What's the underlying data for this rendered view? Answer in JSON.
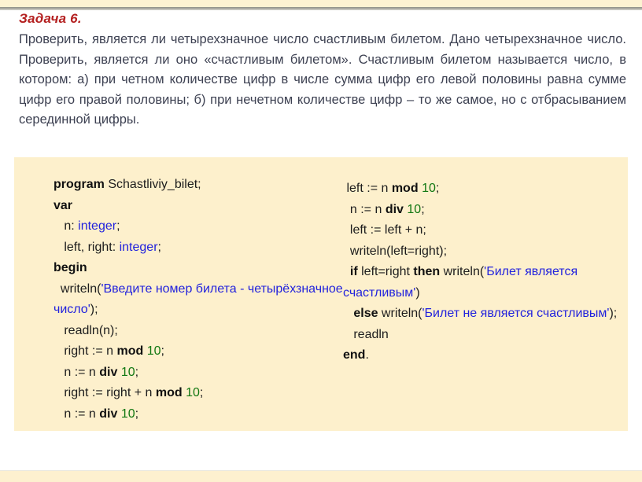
{
  "slide": {
    "task_title": "Задача 6.",
    "task_body": "Проверить, является ли четырехзначное число счастливым билетом. Дано четырехзначное число. Проверить, является ли оно «счастливым билетом». Счастливым билетом называется число, в котором: а) при четном количестве цифр в числе сумма цифр его левой половины равна сумме цифр его правой половины; б) при нечетном количестве цифр – то же самое, но с отбрасыванием серединной цифры.",
    "colors": {
      "title": "#b42020",
      "body_text": "#3d4152",
      "panel_background": "#fdf0cc",
      "band": "#fdf0cf",
      "keyword": "#111111",
      "string": "#2222dd",
      "type": "#2222dd",
      "number": "#117711"
    }
  },
  "code": {
    "left_column": [
      {
        "tokens": [
          {
            "t": "program",
            "c": "kw"
          },
          {
            "t": " Schastliviy_bilet;",
            "c": "plain"
          }
        ]
      },
      {
        "tokens": [
          {
            "t": "var",
            "c": "kw"
          }
        ]
      },
      {
        "tokens": [
          {
            "t": "   n: ",
            "c": "plain"
          },
          {
            "t": "integer",
            "c": "type"
          },
          {
            "t": ";",
            "c": "plain"
          }
        ]
      },
      {
        "tokens": [
          {
            "t": "   left, right: ",
            "c": "plain"
          },
          {
            "t": "integer",
            "c": "type"
          },
          {
            "t": ";",
            "c": "plain"
          }
        ]
      },
      {
        "tokens": [
          {
            "t": "begin",
            "c": "kw"
          }
        ]
      },
      {
        "tokens": [
          {
            "t": "  writeln(",
            "c": "plain"
          },
          {
            "t": "'Введите номер билета - четырёхзначное число'",
            "c": "str"
          },
          {
            "t": ");",
            "c": "plain"
          }
        ]
      },
      {
        "tokens": [
          {
            "t": "   readln(n);",
            "c": "plain"
          }
        ]
      },
      {
        "tokens": [
          {
            "t": "   right := n ",
            "c": "plain"
          },
          {
            "t": "mod",
            "c": "kw"
          },
          {
            "t": " ",
            "c": "plain"
          },
          {
            "t": "10",
            "c": "num"
          },
          {
            "t": ";",
            "c": "plain"
          }
        ]
      },
      {
        "tokens": [
          {
            "t": "   n := n ",
            "c": "plain"
          },
          {
            "t": "div",
            "c": "kw"
          },
          {
            "t": " ",
            "c": "plain"
          },
          {
            "t": "10",
            "c": "num"
          },
          {
            "t": ";",
            "c": "plain"
          }
        ]
      },
      {
        "tokens": [
          {
            "t": "   right := right + n ",
            "c": "plain"
          },
          {
            "t": "mod",
            "c": "kw"
          },
          {
            "t": " ",
            "c": "plain"
          },
          {
            "t": "10",
            "c": "num"
          },
          {
            "t": ";",
            "c": "plain"
          }
        ]
      },
      {
        "tokens": [
          {
            "t": "   n := n ",
            "c": "plain"
          },
          {
            "t": "div",
            "c": "kw"
          },
          {
            "t": " ",
            "c": "plain"
          },
          {
            "t": "10",
            "c": "num"
          },
          {
            "t": ";",
            "c": "plain"
          }
        ]
      }
    ],
    "right_column": [
      {
        "tokens": [
          {
            "t": " left := n ",
            "c": "plain"
          },
          {
            "t": "mod",
            "c": "kw"
          },
          {
            "t": " ",
            "c": "plain"
          },
          {
            "t": "10",
            "c": "num"
          },
          {
            "t": ";",
            "c": "plain"
          }
        ]
      },
      {
        "tokens": [
          {
            "t": "  n := n ",
            "c": "plain"
          },
          {
            "t": "div",
            "c": "kw"
          },
          {
            "t": " ",
            "c": "plain"
          },
          {
            "t": "10",
            "c": "num"
          },
          {
            "t": ";",
            "c": "plain"
          }
        ]
      },
      {
        "tokens": [
          {
            "t": "  left := left + n;",
            "c": "plain"
          }
        ]
      },
      {
        "tokens": [
          {
            "t": "  writeln(left=right);",
            "c": "plain"
          }
        ]
      },
      {
        "tokens": [
          {
            "t": "  ",
            "c": "plain"
          },
          {
            "t": "if",
            "c": "kw"
          },
          {
            "t": " left=right ",
            "c": "plain"
          },
          {
            "t": "then",
            "c": "kw"
          },
          {
            "t": " writeln(",
            "c": "plain"
          },
          {
            "t": "'Билет является счастливым'",
            "c": "str"
          },
          {
            "t": ")",
            "c": "plain"
          }
        ]
      },
      {
        "tokens": [
          {
            "t": "   ",
            "c": "plain"
          },
          {
            "t": "else",
            "c": "kw"
          },
          {
            "t": " writeln(",
            "c": "plain"
          },
          {
            "t": "'Билет не является счастливым'",
            "c": "str"
          },
          {
            "t": ");",
            "c": "plain"
          }
        ]
      },
      {
        "tokens": [
          {
            "t": "   readln",
            "c": "plain"
          }
        ]
      },
      {
        "tokens": [
          {
            "t": "end",
            "c": "kw"
          },
          {
            "t": ".",
            "c": "plain"
          }
        ]
      }
    ]
  }
}
